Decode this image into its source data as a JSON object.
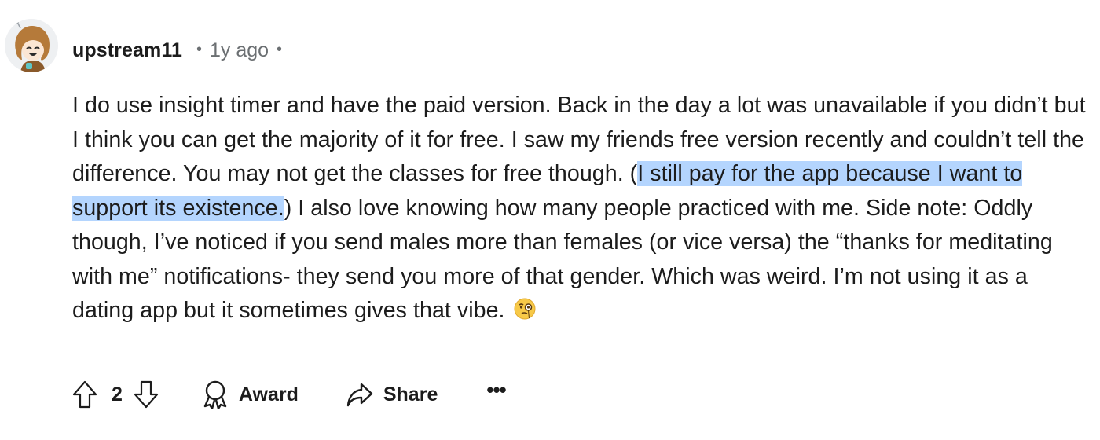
{
  "comment": {
    "author": "upstream11",
    "separator": "•",
    "time_ago": "1y ago",
    "body_before_highlight": "I do use insight timer and have the paid version. Back in the day a lot was unavailable if you didn’t but I think you can get the majority of it for free. I saw my friends free version recently and couldn’t tell the difference. You may not get the classes for free though. (",
    "body_highlighted": "I still pay for the app because I want to support its existence.",
    "body_after_highlight": ") I also love knowing how many people practiced with me. Side note: Oddly though, I’ve noticed if you send males more than females (or vice versa) the “thanks for meditating with me” notifications- they send you more of that gender. Which was weird. I’m not using it as a dating app but it sometimes gives that vibe. ",
    "body_emoji": "face-with-monocle-emoji"
  },
  "actions": {
    "score": "2",
    "award_label": "Award",
    "share_label": "Share",
    "more_label": "•••"
  },
  "colors": {
    "text": "#1c1c1c",
    "meta": "#6b6f72",
    "highlight": "#b4d5fe",
    "icon": "#1c1c1c"
  },
  "icons": {
    "upvote": "arrow-up-outline-icon",
    "downvote": "arrow-down-outline-icon",
    "award": "award-ribbon-icon",
    "share": "share-arrow-icon",
    "more": "ellipsis-icon"
  }
}
